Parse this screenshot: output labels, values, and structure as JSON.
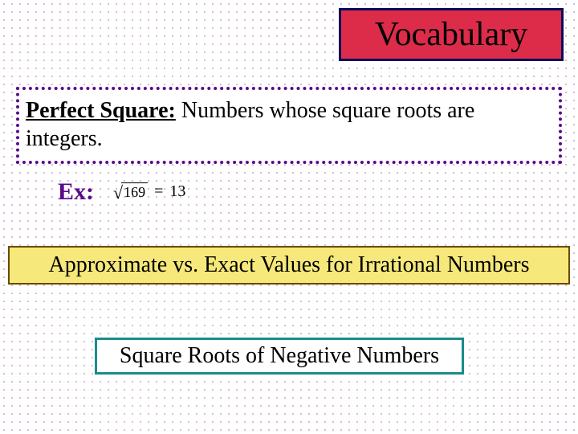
{
  "title": "Vocabulary",
  "definition": {
    "term": "Perfect Square:",
    "body": "  Numbers whose square roots are integers."
  },
  "example": {
    "label": "Ex:",
    "radicand": "169",
    "equals": "=",
    "result": "13"
  },
  "topic1": "Approximate vs. Exact Values for Irrational Numbers",
  "topic2": "Square Roots of Negative Numbers"
}
